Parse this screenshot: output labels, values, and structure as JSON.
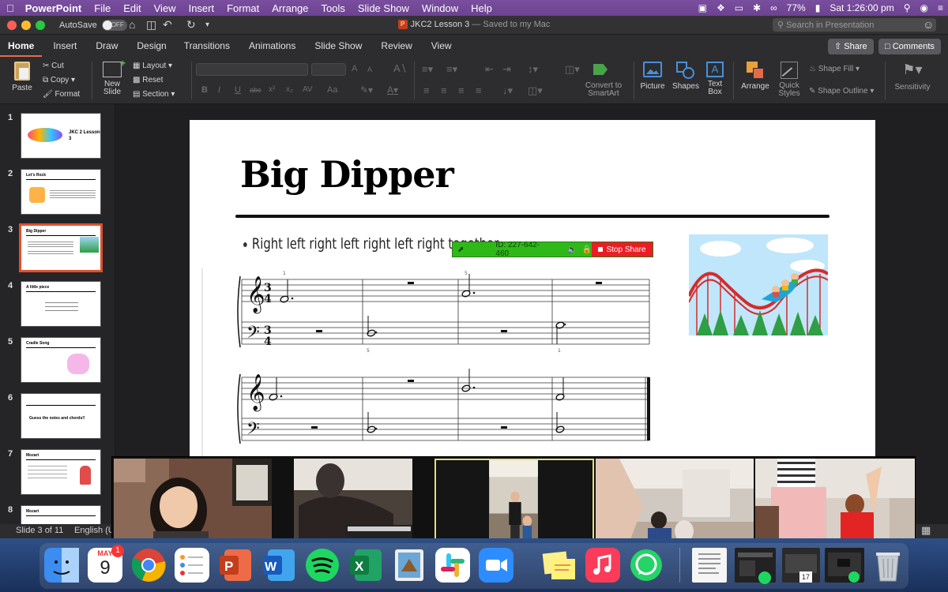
{
  "menubar": {
    "app": "PowerPoint",
    "items": [
      "File",
      "Edit",
      "View",
      "Insert",
      "Format",
      "Arrange",
      "Tools",
      "Slide Show",
      "Window",
      "Help"
    ],
    "battery": "77%",
    "clock": "Sat 1:26:00 pm"
  },
  "titlebar": {
    "autosave_label": "AutoSave",
    "autosave_state": "OFF",
    "doc_title": "JKC2 Lesson 3",
    "saved_status": "— Saved to my Mac",
    "search_placeholder": "Search in Presentation"
  },
  "ribbon_tabs": {
    "tabs": [
      "Home",
      "Insert",
      "Draw",
      "Design",
      "Transitions",
      "Animations",
      "Slide Show",
      "Review",
      "View"
    ],
    "share": "Share",
    "comments": "Comments"
  },
  "ribbon": {
    "paste": "Paste",
    "cut": "Cut",
    "copy": "Copy",
    "format": "Format",
    "new_slide": "New\nSlide",
    "new_slide_1": "New",
    "new_slide_2": "Slide",
    "layout": "Layout",
    "reset": "Reset",
    "section": "Section",
    "font_size_a_up": "A",
    "font_size_a_down": "A",
    "bold": "B",
    "italic": "I",
    "underline": "U",
    "strike": "abc",
    "superscript": "x²",
    "subscript": "x₂",
    "spacing": "AV",
    "change_case": "Aa",
    "convert_smartart_1": "Convert to",
    "convert_smartart_2": "SmartArt",
    "picture": "Picture",
    "shapes": "Shapes",
    "text_box_1": "Text",
    "text_box_2": "Box",
    "arrange": "Arrange",
    "quick_styles_1": "Quick",
    "quick_styles_2": "Styles",
    "shape_fill": "Shape Fill",
    "shape_outline": "Shape Outline",
    "sensitivity": "Sensitivity"
  },
  "thumbnails": [
    {
      "num": "1",
      "title": "JKC 2 Lesson 3"
    },
    {
      "num": "2",
      "title": "Let's Rock"
    },
    {
      "num": "3",
      "title": "Big Dipper"
    },
    {
      "num": "4",
      "title": "A little piece"
    },
    {
      "num": "5",
      "title": "Cradle Song"
    },
    {
      "num": "6",
      "title": "Guess the notes and chords!!"
    },
    {
      "num": "7",
      "title": "Mozart"
    },
    {
      "num": "8",
      "title": "Mozart"
    }
  ],
  "slide": {
    "title": "Big Dipper",
    "bullet": "Right left right left right left right together",
    "measure_num_1": "1",
    "measure_num_5": "5",
    "measure_num_bass_5": "5",
    "measure_num_bass_1": "1"
  },
  "sharebar": {
    "meeting_id": "ID: 227-642-460",
    "stop": "Stop Share"
  },
  "statusbar": {
    "slide_count": "Slide 3 of 11",
    "language": "English (U"
  },
  "dock": {
    "calendar_month": "MAY",
    "calendar_day": "9",
    "calendar_badge": "1",
    "calendar2_day": "17"
  }
}
